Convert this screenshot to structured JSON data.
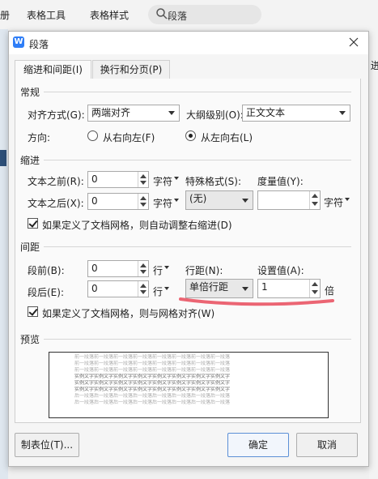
{
  "ribbon": {
    "items": [
      "册",
      "表格工具",
      "表格样式"
    ],
    "search_text": "段落",
    "right_edge_text": "迸"
  },
  "dialog": {
    "title": "段落",
    "app_icon_letter": "W",
    "tabs": [
      {
        "label": "缩进和间距(I)",
        "active": true
      },
      {
        "label": "换行和分页(P)",
        "active": false
      }
    ],
    "general": {
      "section": "常规",
      "alignment_label": "对齐方式(G):",
      "alignment_value": "两端对齐",
      "outline_label": "大纲级别(O):",
      "outline_value": "正文文本",
      "direction_label": "方向:",
      "rtl_label": "从右向左(F)",
      "ltr_label": "从左向右(L)",
      "direction_selected": "ltr"
    },
    "indent": {
      "section": "缩进",
      "before_label": "文本之前(R):",
      "before_value": "0",
      "before_unit": "字符",
      "after_label": "文本之后(X):",
      "after_value": "0",
      "after_unit": "字符",
      "special_label": "特殊格式(S):",
      "special_value": "(无)",
      "measure_label": "度量值(Y):",
      "measure_value": "",
      "measure_unit": "字符",
      "grid_checkbox_label": "如果定义了文档网格，则自动调整右缩进(D)",
      "grid_checked": true
    },
    "spacing": {
      "section": "间距",
      "before_label": "段前(B):",
      "before_value": "0",
      "before_unit": "行",
      "after_label": "段后(E):",
      "after_value": "0",
      "after_unit": "行",
      "line_label": "行距(N):",
      "line_value": "单倍行距",
      "setting_label": "设置值(A):",
      "setting_value": "1",
      "setting_unit": "倍",
      "grid_checkbox_label": "如果定义了文档网格，则与网格对齐(W)",
      "grid_checked": true
    },
    "preview": {
      "section": "预览",
      "lines": [
        "前一段落前一段落前一段落前一段落前一段落前一段落前一段落前一段落",
        "前一段落前一段落前一段落前一段落前一段落前一段落前一段落前一段落",
        "前一段落前一段落前一段落前一段落前一段落前一段落前一段落前一段落",
        "实例文字实例文字实例文字实例文字实例文字实例文字实例文字实例文字",
        "实例文字实例文字实例文字实例文字实例文字实例文字实例文字实例文字",
        "实例文字实例文字实例文字实例文字实例文字实例文字实例文字实例文字",
        "后一段落后一段落后一段落后一段落后一段落后一段落后一段落后一段落",
        "后一段落后一段落后一段落后一段落后一段落后一段落后一段落后一段落"
      ]
    },
    "buttons": {
      "tabs_button": "制表位(T)...",
      "ok": "确定",
      "cancel": "取消"
    }
  },
  "colors": {
    "accent": "#2f7ef7",
    "annotation_red": "#e84a5a"
  }
}
